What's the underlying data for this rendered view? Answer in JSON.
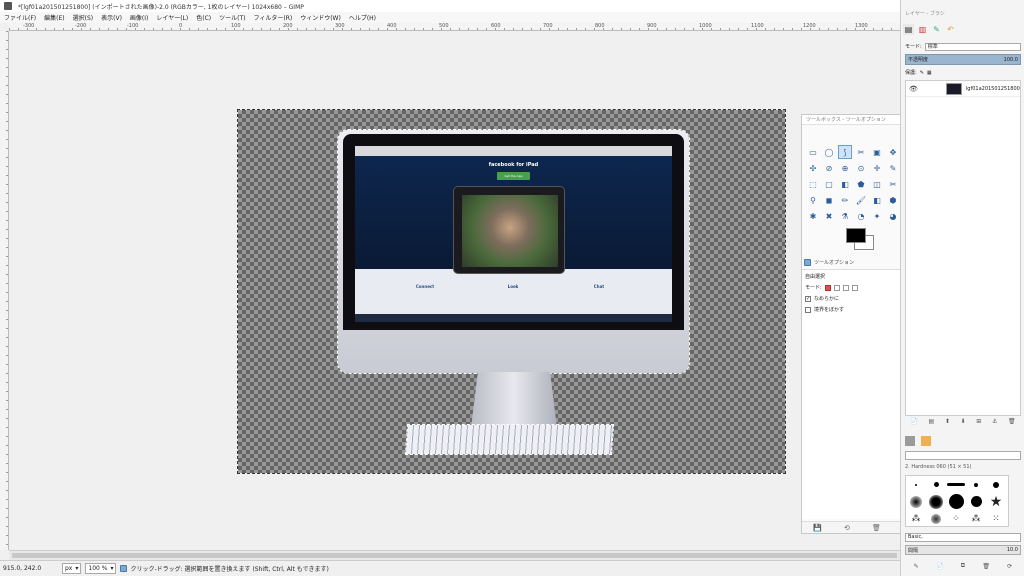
{
  "window": {
    "title": "*[lgf01a201501251800] (インポートされた画像)-2.0 (RGBカラー, 1枚のレイヤー) 1024x680 – GIMP",
    "minimize": "—",
    "maximize": "☐",
    "close": "✕"
  },
  "menubar": {
    "items": [
      "ファイル(F)",
      "編集(E)",
      "選択(S)",
      "表示(V)",
      "画像(I)",
      "レイヤー(L)",
      "色(C)",
      "ツール(T)",
      "フィルター(R)",
      "ウィンドウ(W)",
      "ヘルプ(H)"
    ]
  },
  "ruler": {
    "labels": [
      "-300",
      "-200",
      "-100",
      "0",
      "100",
      "200",
      "300",
      "400",
      "500",
      "600",
      "700",
      "800",
      "900",
      "1000",
      "1100",
      "1200",
      "1300"
    ]
  },
  "canvas": {
    "screen_title": "facebook for iPad",
    "screen_button": "Get the App",
    "features": [
      "Connect",
      "Look",
      "Chat"
    ],
    "apple_logo": ""
  },
  "statusbar": {
    "coords": "915.0, 242.0",
    "unit": "px",
    "zoom": "100 %",
    "message": "クリック-ドラッグ: 選択範囲を置き換えます (Shift, Ctrl, Alt もできます)"
  },
  "toolbox": {
    "title": "ツールボックス - ツールオプション",
    "tools": [
      "▭",
      "◯",
      "⟆",
      "✂",
      "▣",
      "✥",
      "✥",
      "✣",
      "⊘",
      "⊕",
      "⊙",
      "✛",
      "✎",
      "✑",
      "⬚",
      "▢",
      "◧",
      "⬟",
      "◫",
      "✂",
      "A",
      "⚲",
      "◼",
      "✏",
      "🖌",
      "◧",
      "⬢",
      "✚",
      "✱",
      "✖",
      "⚗",
      "◔",
      "✦",
      "◕",
      "✒"
    ],
    "options_tab": "ツールオプション",
    "options_heading": "自由選択",
    "mode_label": "モード:",
    "antialias_label": "なめらかに",
    "feather_label": "境界をぼかす",
    "bottom_icons": [
      "💾",
      "⟲",
      "🗑",
      "↺"
    ]
  },
  "dock": {
    "title": "レイヤー - ブラシ",
    "mode_label": "モード:",
    "mode_value": "標準",
    "opacity_label": "不透明度",
    "opacity_value": "100.0",
    "lock_label": "保護:",
    "layer_name": "lgf01a201501251800",
    "layer_buttons": [
      "📄",
      "▤",
      "⬆",
      "⬇",
      "⊞",
      "⚓",
      "🗑"
    ],
    "brush_filter": "",
    "brush_name": "2. Hardness 060 (51 × 51)",
    "brush_preset": "Basic,",
    "spacing_label": "間隔",
    "spacing_value": "10.0",
    "bottom_icons": [
      "✎",
      "📄",
      "⧉",
      "🗑",
      "⟳"
    ]
  }
}
